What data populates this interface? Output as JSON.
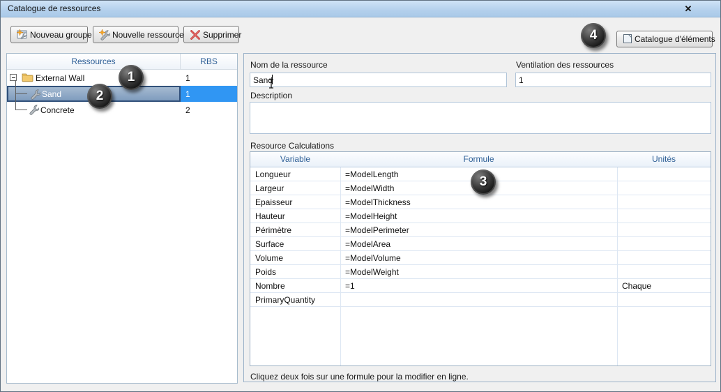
{
  "window": {
    "title": "Catalogue de ressources",
    "close_icon": "✕"
  },
  "toolbar": {
    "new_group": "Nouveau groupe",
    "new_resource": "Nouvelle ressource",
    "delete": "Supprimer",
    "element_catalog": "Catalogue d'éléments"
  },
  "tree": {
    "columns": {
      "resources": "Ressources",
      "rbs": "RBS"
    },
    "rows": [
      {
        "label": "External Wall",
        "rbs": "1",
        "type": "group",
        "selected": false
      },
      {
        "label": "Sand",
        "rbs": "1",
        "type": "resource",
        "selected": true
      },
      {
        "label": "Concrete",
        "rbs": "2",
        "type": "resource",
        "selected": false
      }
    ]
  },
  "form": {
    "name_label": "Nom de la ressource",
    "name_value": "Sand",
    "ventilation_label": "Ventilation des ressources",
    "ventilation_value": "1",
    "description_label": "Description",
    "description_value": "",
    "calc_label": "Resource Calculations",
    "note": "Cliquez deux fois sur une formule pour la modifier en ligne."
  },
  "calc_table": {
    "headers": {
      "variable": "Variable",
      "formula": "Formule",
      "units": "Unités"
    },
    "rows": [
      {
        "variable": "Longueur",
        "formula": "=ModelLength",
        "units": ""
      },
      {
        "variable": "Largeur",
        "formula": "=ModelWidth",
        "units": ""
      },
      {
        "variable": "Epaisseur",
        "formula": "=ModelThickness",
        "units": ""
      },
      {
        "variable": "Hauteur",
        "formula": "=ModelHeight",
        "units": ""
      },
      {
        "variable": "Périmètre",
        "formula": "=ModelPerimeter",
        "units": ""
      },
      {
        "variable": "Surface",
        "formula": "=ModelArea",
        "units": ""
      },
      {
        "variable": "Volume",
        "formula": "=ModelVolume",
        "units": ""
      },
      {
        "variable": "Poids",
        "formula": "=ModelWeight",
        "units": ""
      },
      {
        "variable": "Nombre",
        "formula": "=1",
        "units": "Chaque"
      },
      {
        "variable": "PrimaryQuantity",
        "formula": "",
        "units": ""
      }
    ]
  },
  "badges": [
    "1",
    "2",
    "3",
    "4"
  ],
  "icons": {
    "new_group": "folder-window-with-new-star",
    "new_resource": "wrench-with-new-star",
    "delete": "red-x",
    "element_catalog": "document-page",
    "tree_group": "yellow-folder",
    "tree_resource": "gray-wrench",
    "expander": "minus-box",
    "cursor": "text-ibeam-caret"
  },
  "colors": {
    "titlebar": "#b3d0ec",
    "dialog_bg": "#f0f0f0",
    "selection_rbs": "#3096f3",
    "selection_tree": "#7f9cbe",
    "header_text": "#2e5f96",
    "badge": "#0d0d0d",
    "delete_icon": "#d03c3c",
    "new_star": "#f5a623",
    "folder": "#f2c96d"
  }
}
